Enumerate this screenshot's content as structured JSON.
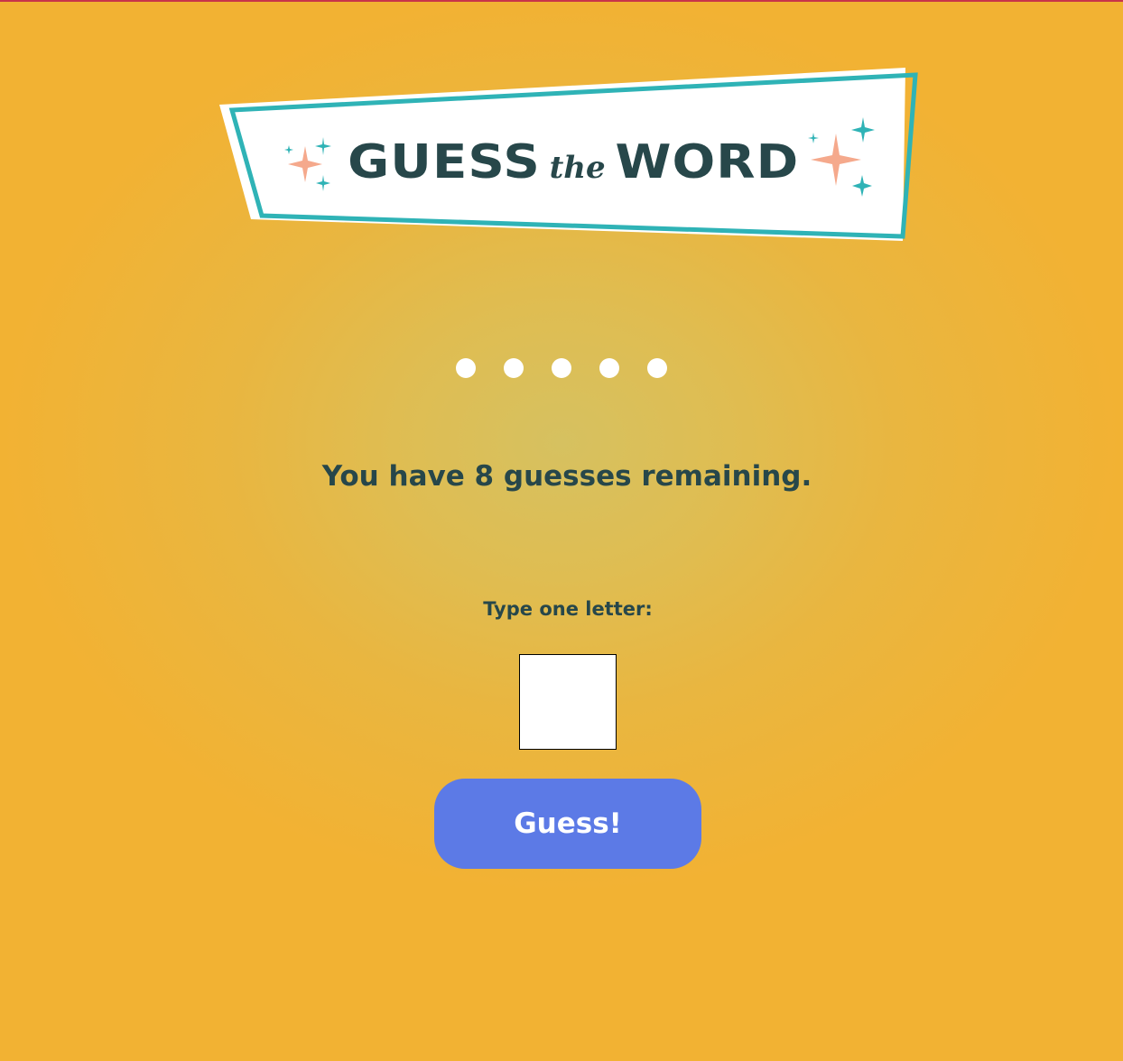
{
  "banner": {
    "word_guess": "GUESS",
    "word_the": "the",
    "word_word": "WORD"
  },
  "word_in_progress": {
    "placeholder_symbol": "●",
    "letter_count": 5
  },
  "status": {
    "remaining_text": "You have 8 guesses remaining."
  },
  "form": {
    "label": "Type one letter:",
    "input_value": "",
    "button_label": "Guess!"
  },
  "colors": {
    "background": "#f2b233",
    "text": "#27474a",
    "accent_teal": "#2fb3b6",
    "accent_peach": "#f5a98c",
    "button": "#5c7ae6"
  }
}
